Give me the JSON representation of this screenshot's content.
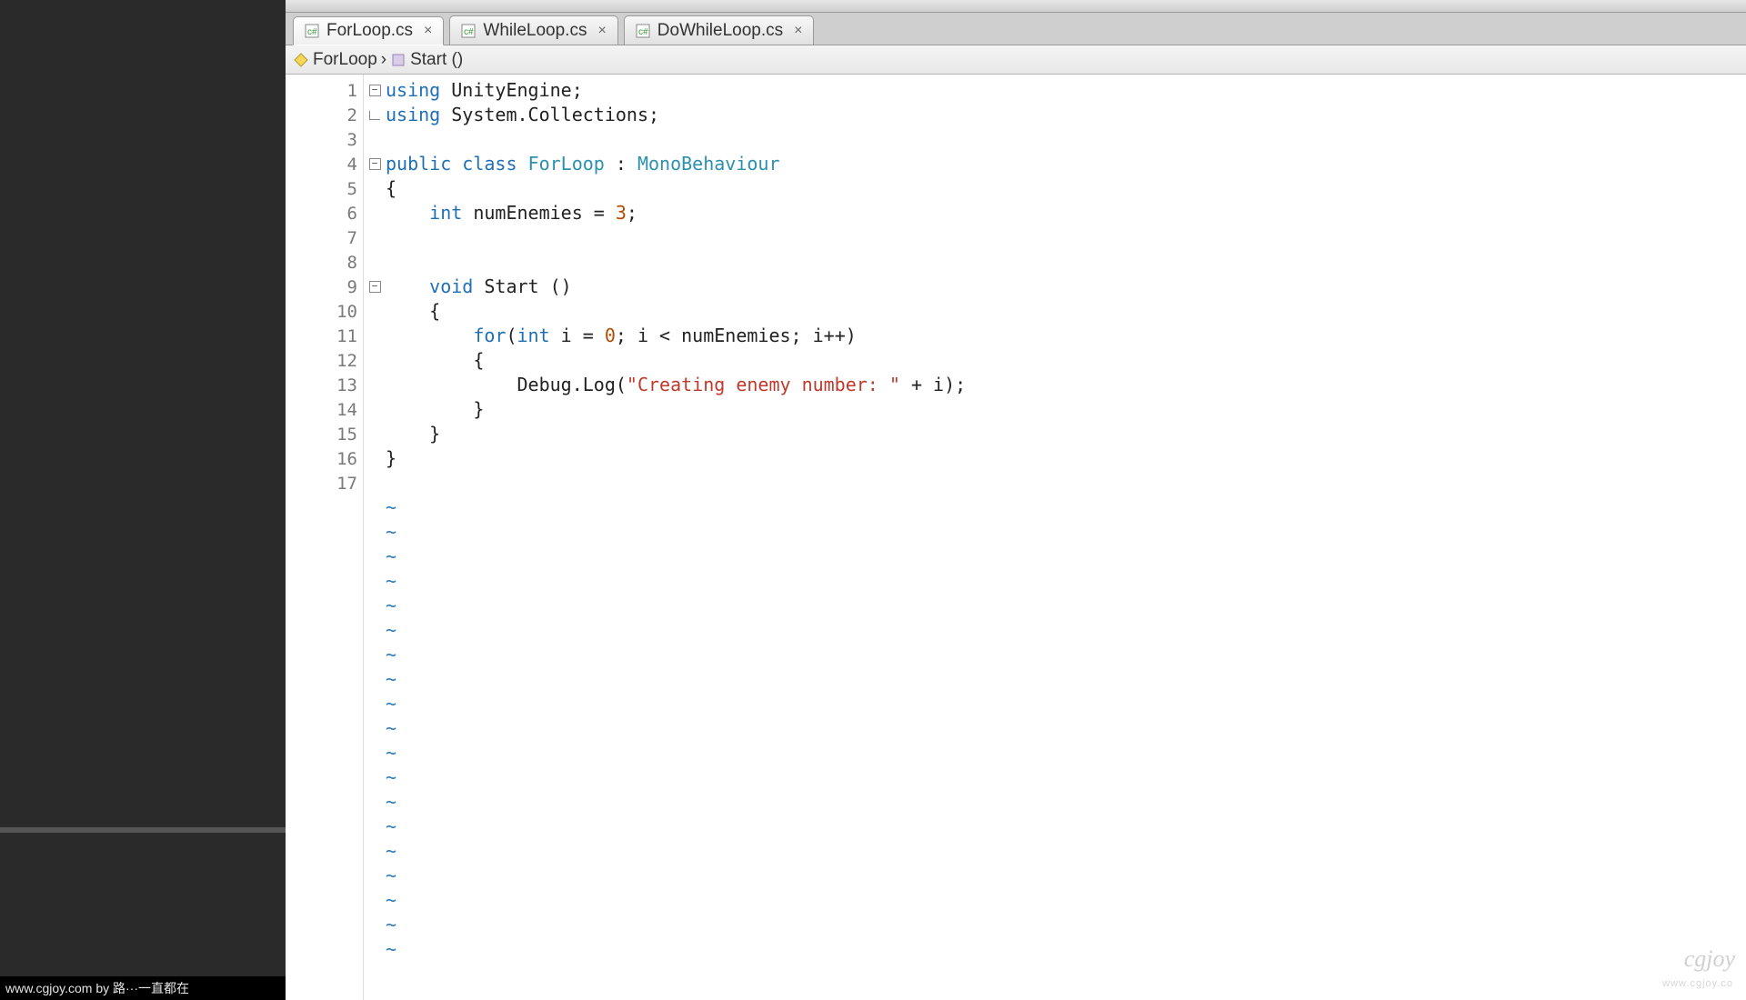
{
  "tabs": [
    {
      "label": "ForLoop.cs",
      "active": true
    },
    {
      "label": "WhileLoop.cs",
      "active": false
    },
    {
      "label": "DoWhileLoop.cs",
      "active": false
    }
  ],
  "breadcrumb": {
    "class": "ForLoop",
    "method": "Start ()"
  },
  "code": {
    "lines": [
      {
        "n": 1,
        "fold": "minus",
        "tokens": [
          [
            "kw",
            "using"
          ],
          [
            "id",
            " UnityEngine;"
          ]
        ]
      },
      {
        "n": 2,
        "fold": "lbottom",
        "tokens": [
          [
            "kw",
            "using"
          ],
          [
            "id",
            " System.Collections;"
          ]
        ]
      },
      {
        "n": 3,
        "tokens": []
      },
      {
        "n": 4,
        "fold": "minus",
        "tokens": [
          [
            "kw",
            "public class"
          ],
          [
            "id",
            " "
          ],
          [
            "cls",
            "ForLoop"
          ],
          [
            "id",
            " : "
          ],
          [
            "type",
            "MonoBehaviour"
          ]
        ]
      },
      {
        "n": 5,
        "tokens": [
          [
            "id",
            "{"
          ]
        ]
      },
      {
        "n": 6,
        "tokens": [
          [
            "id",
            "    "
          ],
          [
            "kw",
            "int"
          ],
          [
            "id",
            " numEnemies = "
          ],
          [
            "num",
            "3"
          ],
          [
            "id",
            ";"
          ]
        ]
      },
      {
        "n": 7,
        "tokens": []
      },
      {
        "n": 8,
        "tokens": []
      },
      {
        "n": 9,
        "fold": "minus",
        "tokens": [
          [
            "id",
            "    "
          ],
          [
            "kw",
            "void"
          ],
          [
            "id",
            " Start ()"
          ]
        ]
      },
      {
        "n": 10,
        "tokens": [
          [
            "id",
            "    {"
          ]
        ]
      },
      {
        "n": 11,
        "tokens": [
          [
            "id",
            "        "
          ],
          [
            "kw",
            "for"
          ],
          [
            "id",
            "("
          ],
          [
            "kw",
            "int"
          ],
          [
            "id",
            " i = "
          ],
          [
            "num",
            "0"
          ],
          [
            "id",
            "; i < numEnemies; i++)"
          ]
        ]
      },
      {
        "n": 12,
        "tokens": [
          [
            "id",
            "        {"
          ]
        ]
      },
      {
        "n": 13,
        "tokens": [
          [
            "id",
            "            Debug.Log("
          ],
          [
            "str",
            "\"Creating enemy number: \""
          ],
          [
            "id",
            " + i);"
          ]
        ]
      },
      {
        "n": 14,
        "tokens": [
          [
            "id",
            "        }"
          ]
        ]
      },
      {
        "n": 15,
        "tokens": [
          [
            "id",
            "    }"
          ]
        ]
      },
      {
        "n": 16,
        "tokens": [
          [
            "id",
            "}"
          ]
        ]
      },
      {
        "n": 17,
        "tokens": []
      }
    ],
    "tilde_rows": 19
  },
  "footer": "www.cgjoy.com by 路···一直都在",
  "watermark": {
    "logo": "cgjoy",
    "sub": "www.cgjoy.co"
  },
  "colors": {
    "keyword": "#1f6fb4",
    "type": "#2b91af",
    "number": "#b04e00",
    "string": "#c0392b"
  }
}
